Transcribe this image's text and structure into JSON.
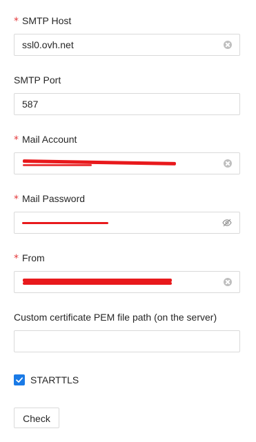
{
  "form": {
    "smtp_host": {
      "required": "*",
      "label": "SMTP Host",
      "value": "ssl0.ovh.net"
    },
    "smtp_port": {
      "label": "SMTP Port",
      "value": "587"
    },
    "mail_account": {
      "required": "*",
      "label": "Mail Account",
      "value_redacted": true
    },
    "mail_password": {
      "required": "*",
      "label": "Mail Password",
      "value_redacted": true
    },
    "from": {
      "required": "*",
      "label": "From",
      "value_redacted": true
    },
    "cert_path": {
      "label": "Custom certificate PEM file path (on the server)",
      "value": ""
    },
    "starttls": {
      "label": "STARTTLS",
      "checked": true
    },
    "check_button": {
      "label": "Check"
    }
  },
  "colors": {
    "required_asterisk": "#e4393c",
    "checkbox_accent": "#1a7ae6",
    "redaction_mark": "#e8191c",
    "input_border": "#d9d9d9",
    "clear_icon": "#bfbfbf"
  },
  "icons": {
    "clear": "clear-icon",
    "password_visibility": "eye-slash-icon",
    "checkbox": "checkmark-icon"
  }
}
